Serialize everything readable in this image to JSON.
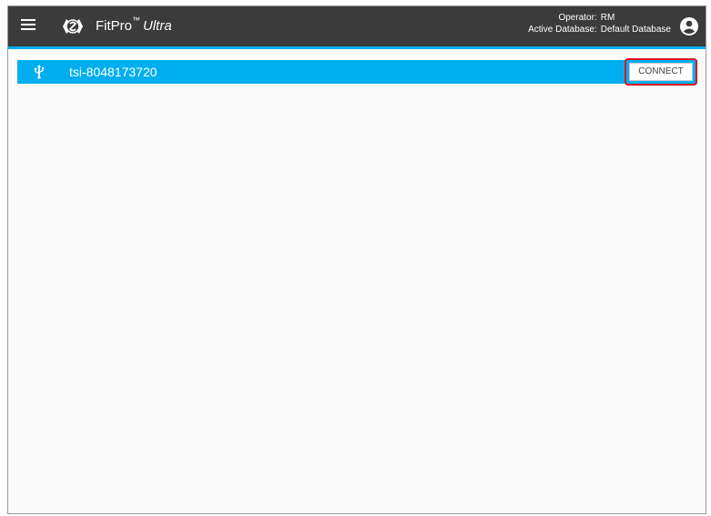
{
  "header": {
    "app_name": "FitPro",
    "trademark": "™",
    "edition": "Ultra",
    "operator_label": "Operator:",
    "operator_value": "RM",
    "database_label": "Active Database:",
    "database_value": "Default Database",
    "logo_text": "TSI",
    "menu_icon": "hamburger-menu-icon",
    "account_icon": "account-circle-icon"
  },
  "devices": [
    {
      "name": "tsi-8048173720",
      "icon": "usb-icon",
      "action_label": "CONNECT"
    }
  ],
  "colors": {
    "appbar": "#3b3b3b",
    "accent": "#00aeef",
    "highlight": "#e3111b",
    "background": "#fafafa"
  }
}
